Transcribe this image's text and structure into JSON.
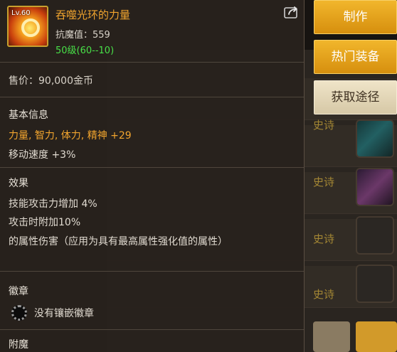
{
  "item": {
    "level_badge": "Lv.60",
    "name": "吞噬光环的力量",
    "resist": "抗魔值：559",
    "level_range": "50级(60--10)",
    "price": "售价：90,000金币"
  },
  "basic_info": {
    "title": "基本信息",
    "primary_stats": "力量, 智力, 体力, 精神 +29",
    "move_speed": "移动速度 +3%"
  },
  "effect": {
    "title": "效果",
    "lines": [
      "技能攻击力增加 4%",
      "攻击时附加10%",
      "的属性伤害（应用为具有最高属性强化值的属性）"
    ]
  },
  "emblem": {
    "title": "徽章",
    "empty_text": "没有镶嵌徽章"
  },
  "enchant": {
    "title": "附魔"
  },
  "buttons": {
    "craft": "制作",
    "hot_gear": "热门装备",
    "source": "获取途径"
  },
  "background_list": {
    "rarity_labels": [
      "史诗",
      "史诗",
      "史诗",
      "史诗"
    ]
  },
  "colors": {
    "name_orange": "#f2a52e",
    "level_green": "#48e048",
    "button_gold": "#e4a41c",
    "button_light": "#e6d9ba"
  },
  "icons": {
    "item": "aura-ring-icon",
    "share": "share-icon",
    "emblem_slot": "emblem-slot-icon"
  }
}
